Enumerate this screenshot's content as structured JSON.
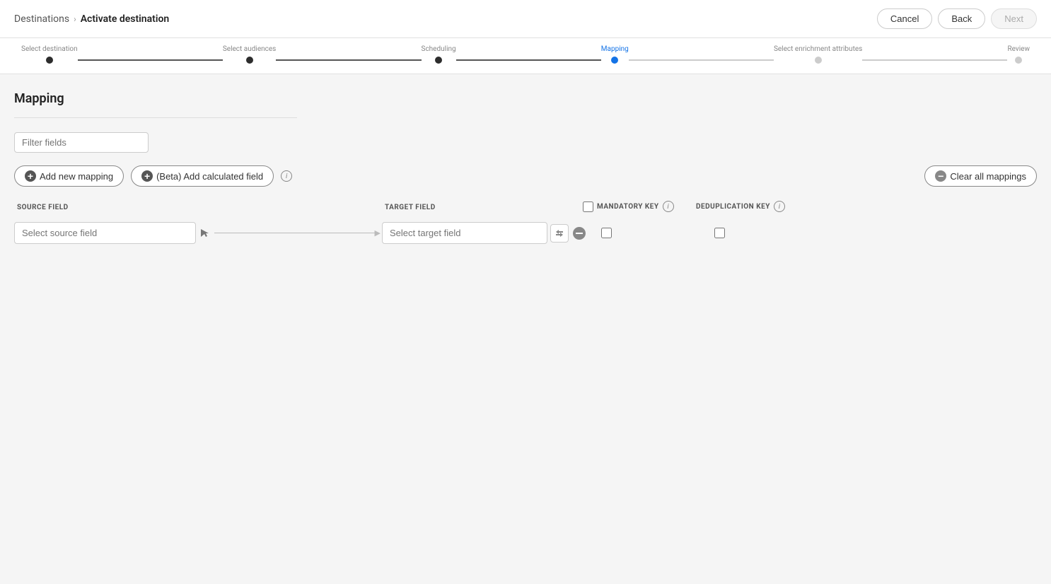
{
  "breadcrumb": {
    "parent": "Destinations",
    "separator": "›",
    "current": "Activate destination"
  },
  "header_buttons": {
    "cancel": "Cancel",
    "back": "Back",
    "next": "Next"
  },
  "steps": [
    {
      "label": "Select destination",
      "state": "completed"
    },
    {
      "label": "Select audiences",
      "state": "completed"
    },
    {
      "label": "Scheduling",
      "state": "completed"
    },
    {
      "label": "Mapping",
      "state": "active"
    },
    {
      "label": "Select enrichment attributes",
      "state": "pending"
    },
    {
      "label": "Review",
      "state": "pending"
    }
  ],
  "page": {
    "title": "Mapping"
  },
  "filter": {
    "placeholder": "Filter fields"
  },
  "actions": {
    "add_mapping": "Add new mapping",
    "add_calculated": "(Beta) Add calculated field",
    "clear_all": "Clear all mappings"
  },
  "columns": {
    "source": "SOURCE FIELD",
    "target": "TARGET FIELD",
    "mandatory": "MANDATORY KEY",
    "dedup": "DEDUPLICATION KEY"
  },
  "mapping_row": {
    "source_placeholder": "Select source field",
    "target_placeholder": "Select target field"
  }
}
